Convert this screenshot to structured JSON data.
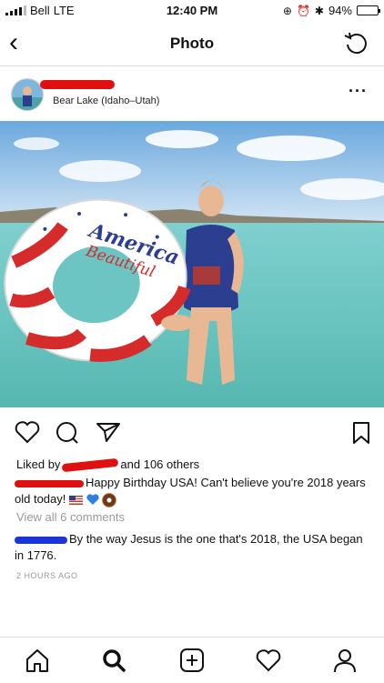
{
  "status": {
    "carrier": "Bell",
    "network": "LTE",
    "time": "12:40 PM",
    "battery_level": 0.94,
    "battery_text": "94%"
  },
  "nav": {
    "title": "Photo"
  },
  "post": {
    "location": "Bear Lake (Idaho–Utah)",
    "photo": {
      "float_text_1": "America",
      "float_text_2": "Beautiful"
    },
    "likes": {
      "prefix": "Liked by",
      "suffix": "and 106 others"
    },
    "caption": {
      "text": "Happy Birthday USA! Can't believe you're 2018 years old today!"
    },
    "view_all": "View all 6 comments",
    "comment": {
      "text": "By the way Jesus is the one that's 2018, the USA began in 1776."
    },
    "time_ago": "2 HOURS AGO"
  },
  "colors": {
    "redaction_red": "#e01010",
    "redaction_blue": "#1a35d8"
  }
}
